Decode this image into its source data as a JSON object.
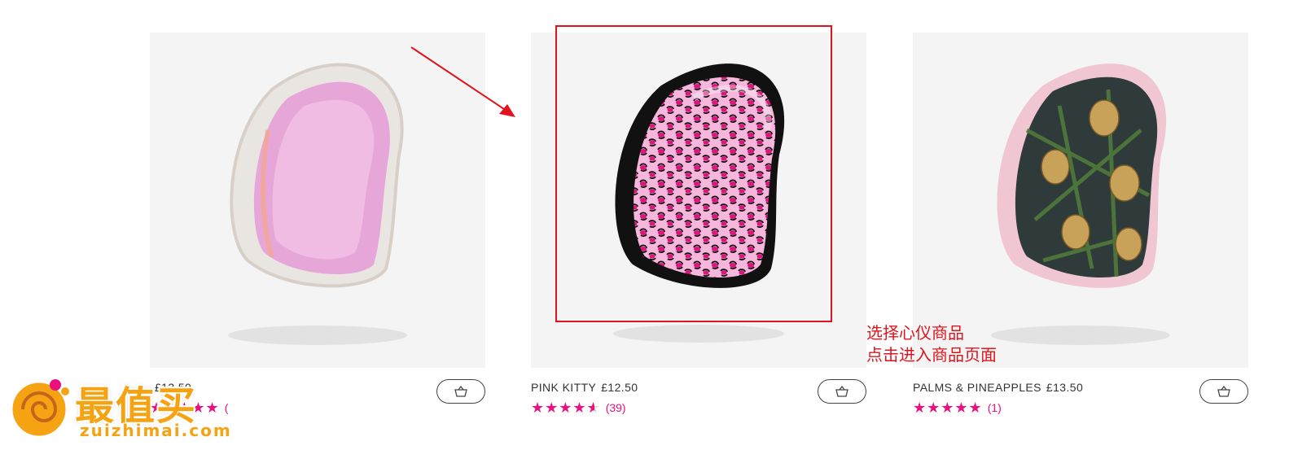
{
  "products": [
    {
      "name": "",
      "price": "£13.50",
      "rating": 5,
      "review_count": "(",
      "image": "holographic-pink-compact-styler",
      "cart_icon": "basket-icon"
    },
    {
      "name": "PINK KITTY",
      "price": "£12.50",
      "rating": 4.5,
      "review_count": "(39)",
      "image": "leopard-print-compact-styler",
      "cart_icon": "basket-icon"
    },
    {
      "name": "PALMS & PINEAPPLES",
      "price": "£13.50",
      "rating": 5,
      "review_count": "(1)",
      "image": "palms-pineapples-compact-styler",
      "cart_icon": "basket-icon"
    }
  ],
  "annotation": {
    "line1": "选择心仪商品",
    "line2": "点击进入商品页面",
    "color": "#e0141e"
  },
  "watermark": {
    "logo_text": "最值买",
    "domain": "zuizhimai.com"
  },
  "colors": {
    "star": "#e8117f",
    "card_background": "#f4f4f4"
  }
}
